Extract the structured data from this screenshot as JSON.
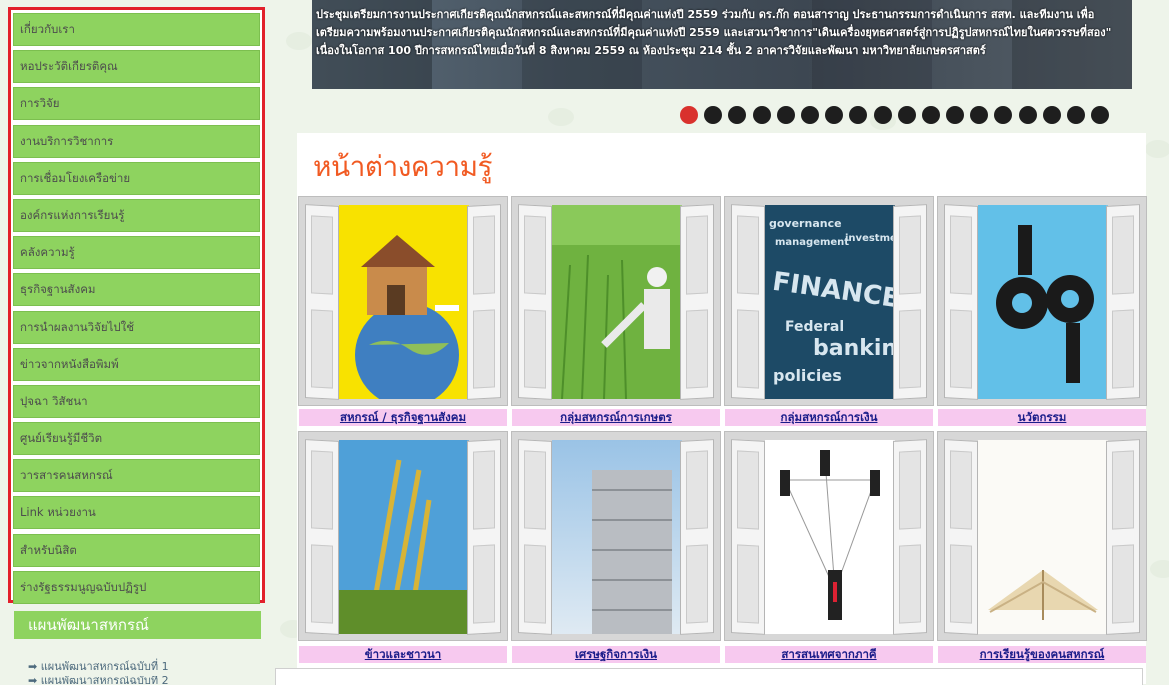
{
  "sidebar": {
    "items": [
      {
        "label": "เกี่ยวกับเรา"
      },
      {
        "label": "หอประวัติเกียรติคุณ"
      },
      {
        "label": "การวิจัย"
      },
      {
        "label": "งานบริการวิชาการ"
      },
      {
        "label": "การเชื่อมโยงเครือข่าย"
      },
      {
        "label": "องค์กรแห่งการเรียนรู้"
      },
      {
        "label": "คลังความรู้"
      },
      {
        "label": "ธุรกิจฐานสังคม"
      },
      {
        "label": "การนำผลงานวิจัยไปใช้"
      },
      {
        "label": "ข่าวจากหนังสือพิมพ์"
      },
      {
        "label": "ปุจฉา วิสัชนา"
      },
      {
        "label": "ศูนย์เรียนรู้มีชีวิต"
      },
      {
        "label": "วารสารคนสหกรณ์"
      },
      {
        "label": "Link หน่วยงาน"
      },
      {
        "label": "สำหรับนิสิต"
      },
      {
        "label": "ร่างรัฐธรรมนูญฉบับปฏิรูป"
      }
    ],
    "plan_header": "แผนพัฒนาสหกรณ์",
    "plan_links": [
      "แผนพัฒนาสหกรณ์ฉบับที่ 1",
      "แผนพัฒนาสหกรณ์ฉบับที่ 2"
    ]
  },
  "banner": {
    "caption": "ประชุมเตรียมการงานประกาศเกียรติคุณนักสหกรณ์และสหกรณ์ที่มีคุณค่าแห่งปี 2559 ร่วมกับ ดร.ก๊ก ตอนสาราญ ประธานกรรมการดำเนินการ สสท. และทีมงาน เพื่อเตรียมความพร้อมงานประกาศเกียรติคุณนักสหกรณ์และสหกรณ์ที่มีคุณค่าแห่งปี 2559 และเสวนาวิชาการ\"เดินเครื่องยุทธศาสตร์สู่การปฏิรูปสหกรณ์ไทยในศตวรรษที่สอง\" เนื่องในโอกาส 100 ปีการสหกรณ์ไทยเมื่อวันที่ 8 สิงหาคม 2559 ณ ห้องประชุม 214 ชั้น 2 อาคารวิจัยและพัฒนา มหาวิทยาลัยเกษตรศาสตร์",
    "slide_count": 18,
    "active_slide": 1
  },
  "knowledge": {
    "title": "หน้าต่างความรู้",
    "tiles": [
      {
        "label": "สหกรณ์ / ธุรกิจฐานสังคม",
        "scene": "globe-house"
      },
      {
        "label": "กลุ่มสหกรณ์การเกษตร",
        "scene": "rice-field"
      },
      {
        "label": "กลุ่มสหกรณ์การเงิน",
        "scene": "finance-words"
      },
      {
        "label": "นวัตกรรม",
        "scene": "gears"
      },
      {
        "label": "ข้าวและชาวนา",
        "scene": "rice-stalks"
      },
      {
        "label": "เศรษฐกิจการเงิน",
        "scene": "coin-stack"
      },
      {
        "label": "สารสนเทศจากภาคี",
        "scene": "network-people"
      },
      {
        "label": "การเรียนรู้ของคนสหกรณ์",
        "scene": "open-book"
      }
    ],
    "finance_words": [
      "FINANCE",
      "banking",
      "investment",
      "policies",
      "Federal",
      "governance",
      "management"
    ]
  },
  "colors": {
    "menu_green": "#8ed35f",
    "highlight_red": "#e2202b",
    "title_orange": "#f15a22",
    "caption_pink": "#f7c9ef",
    "link_blue": "#1b1d8a",
    "active_dot": "#d9312d"
  }
}
